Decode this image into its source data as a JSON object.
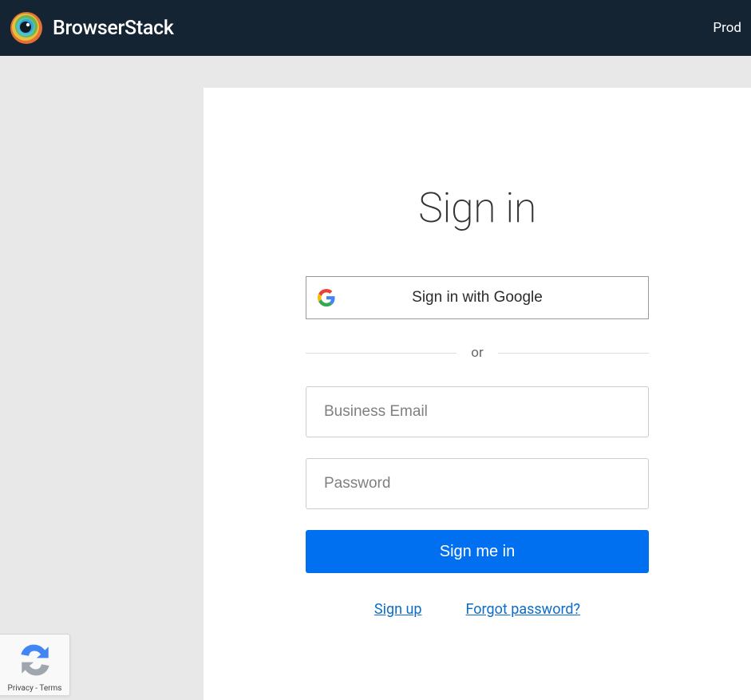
{
  "header": {
    "brand": "BrowserStack",
    "nav_item": "Prod"
  },
  "signin": {
    "title": "Sign in",
    "google_btn_label": "Sign in with Google",
    "divider_text": "or",
    "email_placeholder": "Business Email",
    "password_placeholder": "Password",
    "submit_label": "Sign me in",
    "signup_link": "Sign up",
    "forgot_link": "Forgot password?"
  },
  "recaptcha": {
    "footnote": "Privacy - Terms"
  }
}
